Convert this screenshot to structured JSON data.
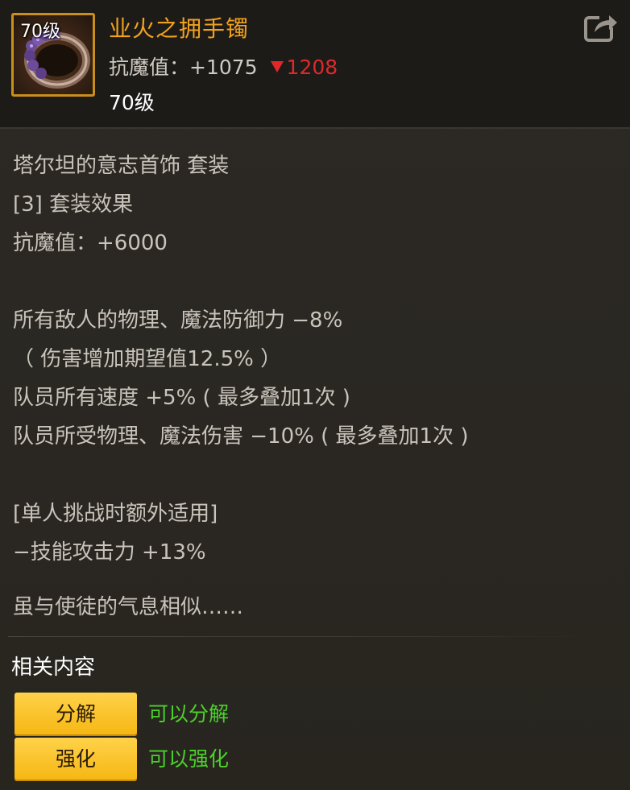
{
  "header": {
    "icon_level": "70级",
    "item_name": "业火之拥手镯",
    "stat_label": "抗魔值：",
    "stat_value": "+1075",
    "stat_compare": "1208",
    "level_text": "70级",
    "share_icon": "share-icon"
  },
  "body": {
    "lines": [
      "塔尔坦的意志首饰 套装",
      "[3] 套装效果",
      "抗魔值：+6000",
      "",
      "所有敌人的物理、魔法防御力 −8%",
      "（ 伤害增加期望值12.5% ）",
      "队员所有速度 +5% ( 最多叠加1次 )",
      "队员所受物理、魔法伤害 −10% ( 最多叠加1次 )",
      "",
      "[单人挑战时额外适用]",
      "−技能攻击力 +13%",
      "虽与使徒的气息相似……"
    ]
  },
  "related": {
    "title": "相关内容",
    "actions": [
      {
        "button": "分解",
        "desc": "可以分解"
      },
      {
        "button": "强化",
        "desc": "可以强化"
      }
    ]
  },
  "colors": {
    "name": "#f0a21e",
    "stat_down": "#e0282a",
    "action_desc": "#4bd12b",
    "button_bg": "#f5b612"
  }
}
